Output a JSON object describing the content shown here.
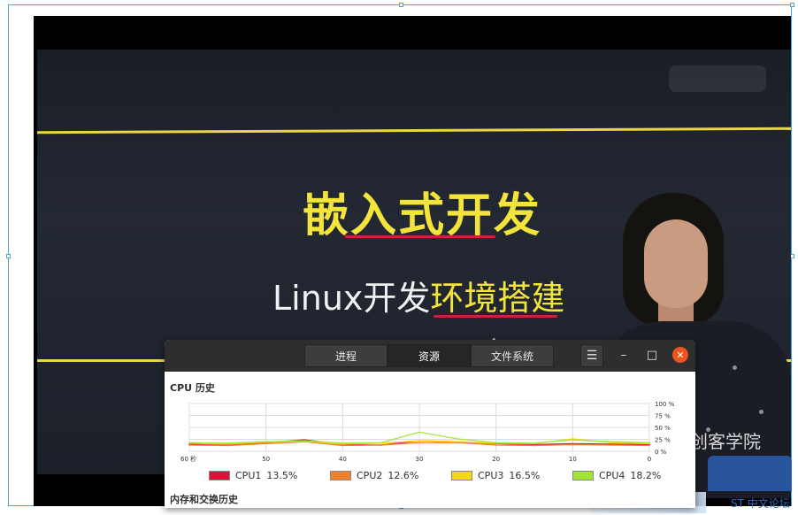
{
  "video": {
    "board_title": "嵌入式开发",
    "subtitle_white": "Linux开发",
    "subtitle_yellow": "环境搭建",
    "brand_watermark": "创客学院",
    "forum_watermark": "ST 中文论坛"
  },
  "monitor": {
    "tabs": [
      {
        "label": "进程",
        "active": false
      },
      {
        "label": "资源",
        "active": true
      },
      {
        "label": "文件系统",
        "active": false
      }
    ],
    "menu_icon": "hamburger-menu-icon",
    "minimize_label": "–",
    "maximize_label": "□",
    "close_label": "✕",
    "cpu_history_title": "CPU 历史",
    "memory_history_title": "内存和交换历史",
    "x_ticks": [
      "60 秒",
      "50",
      "40",
      "30",
      "20",
      "10",
      "0"
    ],
    "y_ticks": [
      "100 %",
      "75 %",
      "50 %",
      "25 %",
      "0 %"
    ],
    "cpus": [
      {
        "name": "CPU1",
        "value": "13.5%",
        "color": "#dc143c"
      },
      {
        "name": "CPU2",
        "value": "12.6%",
        "color": "#f07f2e"
      },
      {
        "name": "CPU3",
        "value": "16.5%",
        "color": "#f5d90c"
      },
      {
        "name": "CPU4",
        "value": "18.2%",
        "color": "#a3e43b"
      }
    ]
  },
  "chart_data": {
    "type": "line",
    "title": "CPU 历史",
    "xlabel": "",
    "ylabel": "",
    "x": [
      60,
      55,
      50,
      45,
      40,
      35,
      30,
      25,
      20,
      15,
      10,
      5,
      0
    ],
    "xlim": [
      60,
      0
    ],
    "ylim": [
      0,
      100
    ],
    "series": [
      {
        "name": "CPU1",
        "values": [
          15,
          14,
          18,
          24,
          14,
          13,
          22,
          20,
          16,
          14,
          16,
          15,
          14
        ]
      },
      {
        "name": "CPU2",
        "values": [
          13,
          12,
          16,
          20,
          12,
          13,
          18,
          18,
          13,
          12,
          14,
          13,
          12
        ]
      },
      {
        "name": "CPU3",
        "values": [
          17,
          15,
          19,
          21,
          15,
          17,
          22,
          20,
          17,
          16,
          26,
          18,
          16
        ]
      },
      {
        "name": "CPU4",
        "values": [
          18,
          17,
          20,
          22,
          17,
          18,
          40,
          26,
          18,
          17,
          24,
          20,
          18
        ]
      }
    ],
    "grid": true,
    "legend": "bottom"
  }
}
